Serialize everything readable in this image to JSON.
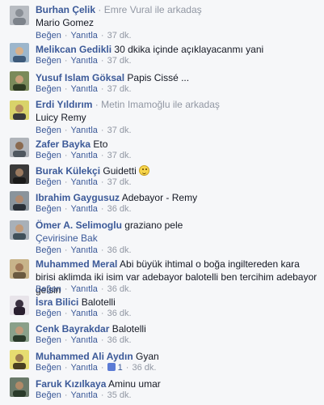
{
  "actions": {
    "like": "Beğen",
    "reply": "Yanıtla",
    "translate": "Çevirisine Bak"
  },
  "comments": [
    {
      "author": "Burhan Çelik",
      "tag_sep": " · ",
      "tag_friend": "Emre Vural",
      "tag_suffix": " ile arkadaş",
      "text": "Mario Gomez",
      "time": "37 dk.",
      "avatar_color": "#9aa0a8"
    },
    {
      "author": "Melikcan Gedikli",
      "text": "30 dkika içinde açıklayacanmı yani",
      "time": "37 dk.",
      "avatar_color": "#6e8ca8"
    },
    {
      "author": "Yusuf Islam Göksal",
      "text": "Papis Cissé ...",
      "time": "37 dk.",
      "avatar_color": "#5a6b4a"
    },
    {
      "author": "Erdi Yıldırım",
      "tag_sep": " · ",
      "tag_friend": "Metin Imamoğlu",
      "tag_suffix": " ile arkadaş",
      "text": "Luicy Remy",
      "time": "37 dk.",
      "avatar_color": "#c7c24a"
    },
    {
      "author": "Zafer Bayka",
      "text": "Eto",
      "time": "37 dk.",
      "avatar_color": "#8a8f96"
    },
    {
      "author": "Burak Külekçi",
      "text": "Guidetti",
      "time": "37 dk.",
      "avatar_color": "#4a4a4a"
    },
    {
      "author": "Ibrahim Gaygusuz",
      "text": "Adebayor - Remy",
      "time": "36 dk.",
      "avatar_color": "#5a6570"
    },
    {
      "author": "Ömer A. Selimoglu",
      "text": "graziano pele",
      "time": "36 dk.",
      "avatar_color": "#707a80"
    },
    {
      "author": "Muhammed Meral",
      "text": "Abi büyük ihtimal o boğa ingiltereden kara birisi aklimda iki isim var adebayor balotelli ben tercihim adebayor gelsin",
      "time": "36 dk.",
      "avatar_color": "#a08a6a"
    },
    {
      "author": "İsra Bilici",
      "text": "Balotelli",
      "time": "36 dk.",
      "avatar_color": "#3a3040"
    },
    {
      "author": "Cenk Bayrakdar",
      "text": "Balotelli",
      "time": "36 dk.",
      "avatar_color": "#6a7a6a"
    },
    {
      "author": "Muhammed Ali Aydın",
      "text": "Gyan",
      "time": "36 dk.",
      "like_count": "1",
      "avatar_color": "#d0c030"
    },
    {
      "author": "Faruk Kızılkaya",
      "text": "Aminu umar",
      "time": "35 dk.",
      "avatar_color": "#4a5a4a"
    }
  ]
}
